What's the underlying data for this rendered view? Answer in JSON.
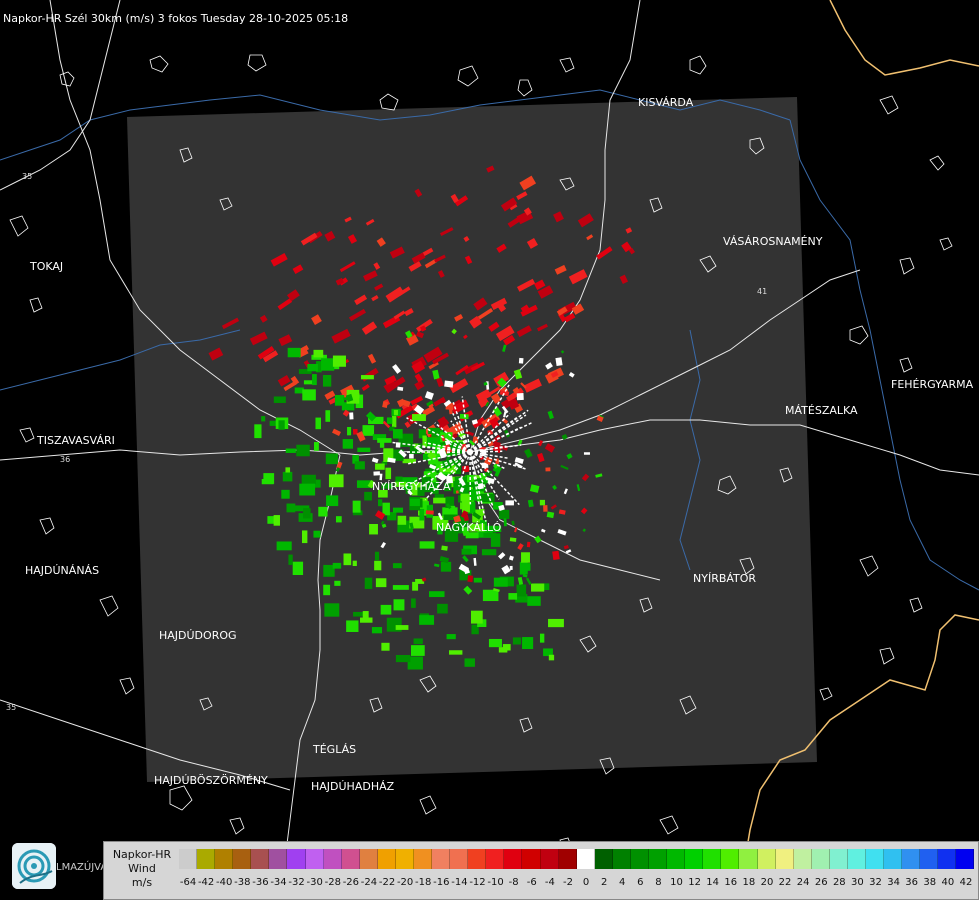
{
  "title": "Napkor-HR Szél 30km (m/s) 3 fokos Tuesday 28-10-2025 05:18",
  "towns": [
    {
      "id": "kisvarda",
      "name": "KISVÁRDA"
    },
    {
      "id": "tokaj",
      "name": "TOKAJ"
    },
    {
      "id": "vasarosnameny",
      "name": "VÁSÁROSNAMÉNY"
    },
    {
      "id": "tiszavasvari",
      "name": "TISZAVASVÁRI"
    },
    {
      "id": "mateszalka",
      "name": "MÁTÉSZALKA"
    },
    {
      "id": "fehergyarmat",
      "name": "FEHÉRGYARMA"
    },
    {
      "id": "nyiregyhaza",
      "name": "NYÍREGYHÁZA"
    },
    {
      "id": "nagykallo",
      "name": "NAGYKÁLLÓ"
    },
    {
      "id": "hajdunanas",
      "name": "HAJDÚNÁNÁS"
    },
    {
      "id": "nyirbator",
      "name": "NYÍRBÁTOR"
    },
    {
      "id": "hajdudorog",
      "name": "HAJDÚDOROG"
    },
    {
      "id": "teglas",
      "name": "TÉGLÁS"
    },
    {
      "id": "hajduboszormeny",
      "name": "HAJDÚBÖSZÖRMÉNY"
    },
    {
      "id": "hajduhadhaz",
      "name": "HAJDÚHADHÁZ"
    },
    {
      "id": "hajdunanas_partial",
      "name": "LMAZÚJVÁR"
    }
  ],
  "road_numbers": [
    "35",
    "36",
    "41",
    "35"
  ],
  "legend": {
    "label_line1": "Napkor-HR",
    "label_line2": "Wind",
    "label_line3": "m/s",
    "ticks": [
      "-64",
      "-42",
      "-40",
      "-38",
      "-36",
      "-34",
      "-32",
      "-30",
      "-28",
      "-26",
      "-24",
      "-22",
      "-20",
      "-18",
      "-16",
      "-14",
      "-12",
      "-10",
      "-8",
      "-6",
      "-4",
      "-2",
      "0",
      "2",
      "4",
      "6",
      "8",
      "10",
      "12",
      "14",
      "16",
      "18",
      "20",
      "22",
      "24",
      "26",
      "28",
      "30",
      "32",
      "34",
      "36",
      "38",
      "40",
      "42"
    ],
    "colors": [
      "#cccccc",
      "#aaaa00",
      "#b08000",
      "#a86010",
      "#a85050",
      "#a050a0",
      "#a040f0",
      "#c060f0",
      "#c050c0",
      "#d05090",
      "#e08040",
      "#f0a000",
      "#f0b000",
      "#f09020",
      "#f08060",
      "#f07050",
      "#f04020",
      "#f02020",
      "#e00010",
      "#d00000",
      "#c00010",
      "#a00000",
      "#ffffff",
      "#006000",
      "#008000",
      "#009000",
      "#00a000",
      "#00b800",
      "#00d000",
      "#20e000",
      "#50ee00",
      "#90f040",
      "#d0f060",
      "#f0f080",
      "#c0f0a0",
      "#a0f0b0",
      "#80f0d0",
      "#60f0e0",
      "#40e0f0",
      "#30c0f0",
      "#3090f0",
      "#2060f0",
      "#1030f0",
      "#0000f0"
    ]
  },
  "logo_text": "LMAZÚJVÁR"
}
